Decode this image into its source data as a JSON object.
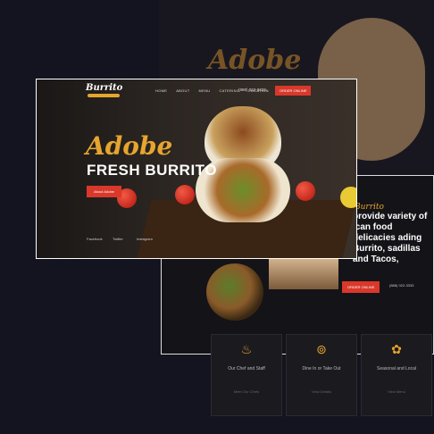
{
  "colors": {
    "accent": "#d9382b",
    "gold": "#e6a52f",
    "background": "#141420"
  },
  "main_site": {
    "logo": "Burrito",
    "nav": [
      "HOME",
      "ABOUT",
      "MENU",
      "CATERING",
      "LOCATION"
    ],
    "phone": "(888) 022-3333",
    "order_button": "ORDER ONLINE",
    "hero_title": "Adobe",
    "hero_subtitle": "FRESH BURRITO",
    "hero_button": "About Adobe",
    "social": [
      "Facebook",
      "Twitter",
      "Instagram"
    ]
  },
  "background_site": {
    "title": "Adobe"
  },
  "about_section": {
    "brand": "Burrito",
    "headline": "provide variety of ican food delicacies ading Burrito, sadillas and Tacos,",
    "paragraph": "",
    "button": "ORDER ONLINE",
    "phone": "(888) 022-3333"
  },
  "features": [
    {
      "icon": "chef-icon",
      "title": "Our Chef and Staff",
      "link": "Meet Our Chefs"
    },
    {
      "icon": "plate-icon",
      "title": "Dine In or Take Out",
      "link": "View Details"
    },
    {
      "icon": "ingredients-icon",
      "title": "Seasonal and Local",
      "link": "View Menu"
    }
  ]
}
